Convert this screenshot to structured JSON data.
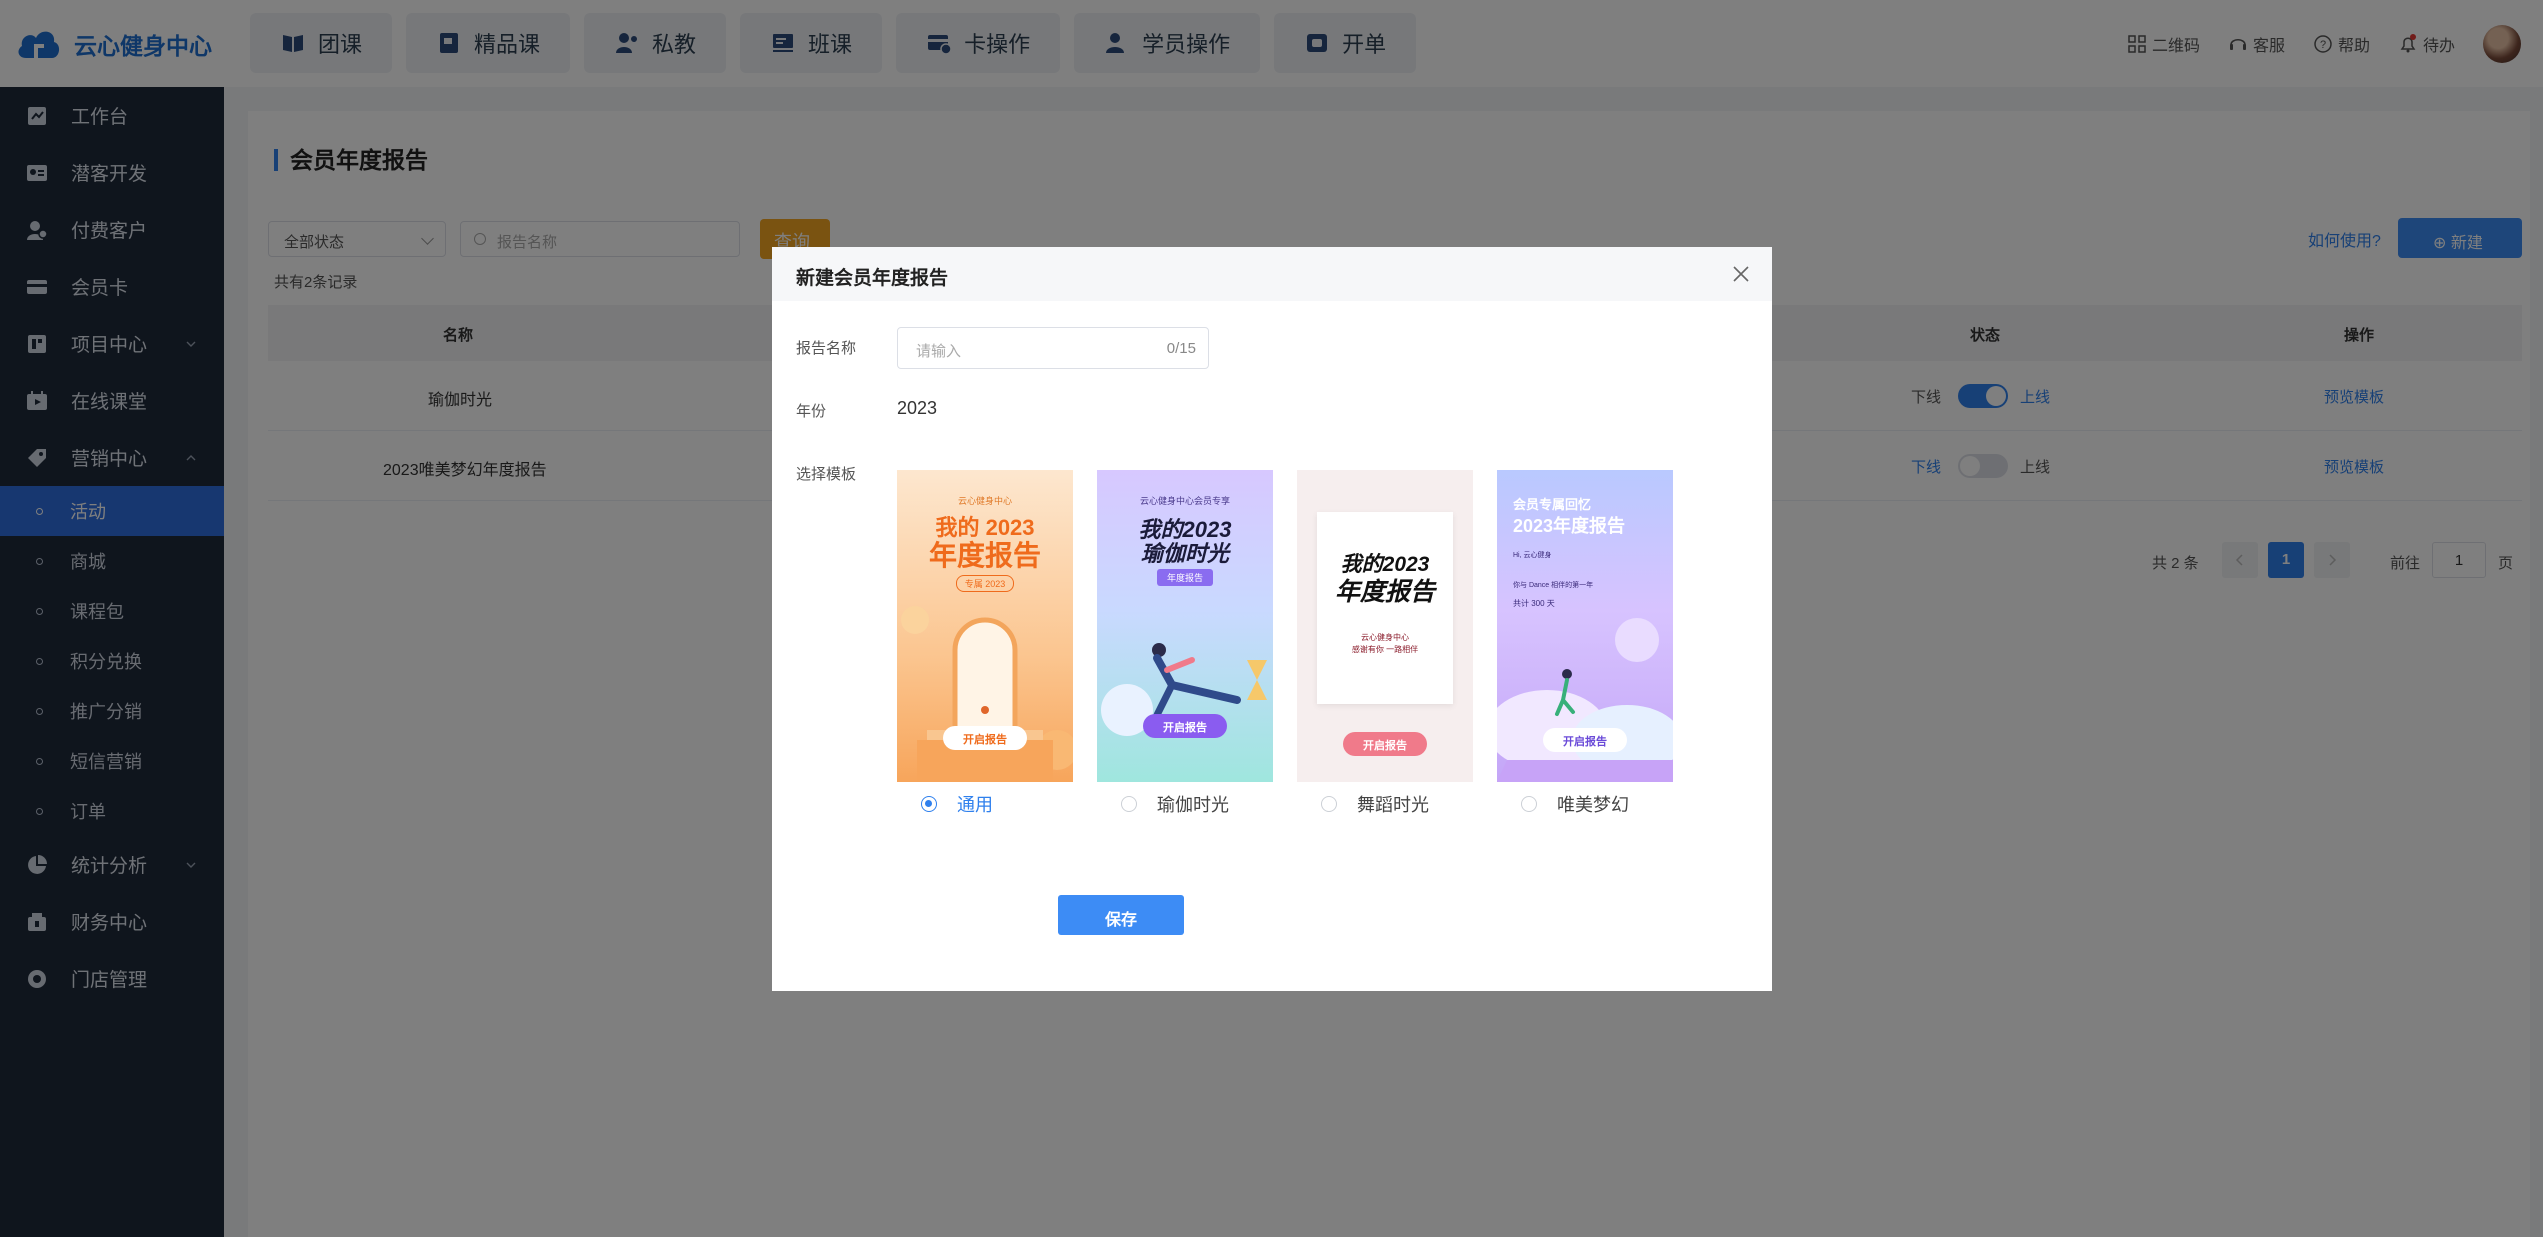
{
  "brand": {
    "name": "云心健身中心"
  },
  "topnav": [
    {
      "label": "团课",
      "icon": "book-icon"
    },
    {
      "label": "精品课",
      "icon": "premium-course-icon"
    },
    {
      "label": "私教",
      "icon": "personal-trainer-icon"
    },
    {
      "label": "班课",
      "icon": "class-icon"
    },
    {
      "label": "卡操作",
      "icon": "card-operation-icon"
    },
    {
      "label": "学员操作",
      "icon": "student-operation-icon"
    },
    {
      "label": "开单",
      "icon": "order-icon"
    }
  ],
  "toolbar": {
    "qrcode": "二维码",
    "service": "客服",
    "help": "帮助",
    "todo": "待办"
  },
  "sidebar": {
    "items": [
      {
        "label": "工作台",
        "icon": "workbench-icon"
      },
      {
        "label": "潜客开发",
        "icon": "prospect-icon"
      },
      {
        "label": "付费客户",
        "icon": "customer-icon"
      },
      {
        "label": "会员卡",
        "icon": "membership-card-icon"
      },
      {
        "label": "项目中心",
        "icon": "project-icon"
      },
      {
        "label": "在线课堂",
        "icon": "online-class-icon"
      },
      {
        "label": "营销中心",
        "icon": "marketing-icon"
      }
    ],
    "sub_items": [
      "活动",
      "商城",
      "课程包",
      "积分兑换",
      "推广分销",
      "短信营销",
      "订单"
    ],
    "bottom_items": [
      {
        "label": "统计分析",
        "icon": "statistics-icon"
      },
      {
        "label": "财务中心",
        "icon": "finance-icon"
      },
      {
        "label": "门店管理",
        "icon": "store-icon"
      }
    ]
  },
  "page": {
    "title": "会员年度报告",
    "filter_status": "全部状态",
    "search_placeholder": "报告名称",
    "query_label": "查询",
    "record_count": "共有2条记录",
    "howto_label": "如何使用?",
    "new_label": "新建",
    "columns": {
      "name": "名称",
      "status": "状态",
      "action": "操作"
    },
    "rows": [
      {
        "name": "瑜伽时光",
        "off": "下线",
        "on": "上线",
        "online": true,
        "action": "预览模板"
      },
      {
        "name": "2023唯美梦幻年度报告",
        "off": "下线",
        "on": "上线",
        "online": false,
        "action": "预览模板"
      }
    ],
    "pager": {
      "total": "共 2 条",
      "current": "1",
      "goto": "前往",
      "goto_value": "1",
      "page_unit": "页"
    }
  },
  "modal": {
    "title": "新建会员年度报告",
    "name_label": "报告名称",
    "name_placeholder": "请输入",
    "name_count": "0/15",
    "year_label": "年份",
    "year_value": "2023",
    "template_label": "选择模板",
    "templates": [
      {
        "label": "通用",
        "selected": true,
        "lines": [
          "我的 2023",
          "年度报告"
        ],
        "small": "云心健身中心",
        "tag": "专属 2023",
        "button": "开启报告"
      },
      {
        "label": "瑜伽时光",
        "selected": false,
        "lines": [
          "我的2023",
          "瑜伽时光"
        ],
        "small": "云心健身中心会员专享",
        "tag": "年度报告",
        "button": "开启报告"
      },
      {
        "label": "舞蹈时光",
        "selected": false,
        "lines": [
          "我的2023",
          "年度报告"
        ],
        "small": "云心健身中心",
        "caption": "感谢有你 一路相伴",
        "button": "开启报告"
      },
      {
        "label": "唯美梦幻",
        "selected": false,
        "lines": [
          "会员专属回忆",
          "2023年度报告"
        ],
        "small": "Hi, 云心健身",
        "note1": "你与 Dance 相伴的第一年",
        "note2": "共计 300 天",
        "button": "开启报告"
      }
    ],
    "save_label": "保存"
  },
  "colors": {
    "accent": "#2f80ed",
    "sidebar_bg": "#1e2a3b",
    "query_button": "#f5a623"
  }
}
